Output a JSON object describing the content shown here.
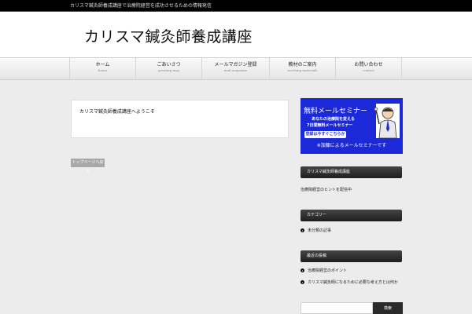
{
  "site": {
    "description": "カリスマ鍼灸師養成講座で治療院経営を成功させるための情報発信",
    "title": "カリスマ鍼灸師養成講座"
  },
  "nav": {
    "items": [
      {
        "label": "ホーム",
        "sub": "home"
      },
      {
        "label": "ごあいさつ",
        "sub": "greeting msg"
      },
      {
        "label": "メールマガジン登録",
        "sub": "mail magazine"
      },
      {
        "label": "教材のご案内",
        "sub": "teaching materials"
      },
      {
        "label": "お問い合わせ",
        "sub": "contact"
      }
    ]
  },
  "main": {
    "article_title": "カリスマ鍼灸師養成講座へようこそ",
    "tag_button": "トップページへ戻る"
  },
  "banner": {
    "title": "無料メールセミナー",
    "line1": "あなたの治療院を変える",
    "line2": "7日間無料メールセミナー",
    "cta": "登録は今すぐこちらから",
    "footer": "※加藤によるメールセミナーです"
  },
  "sidebar": {
    "widget1": {
      "title": "カリスマ鍼灸師養成講座",
      "text": "治療院経営のヒントを配信中"
    },
    "widget2": {
      "title": "カテゴリー",
      "links": [
        "未分類の記事"
      ]
    },
    "widget3": {
      "title": "最近の投稿",
      "links": [
        "治療院経営のポイント",
        "カリスマ鍼灸師になるために必要な考え方とは何か"
      ]
    },
    "search": {
      "placeholder": "",
      "button": "検索"
    }
  }
}
